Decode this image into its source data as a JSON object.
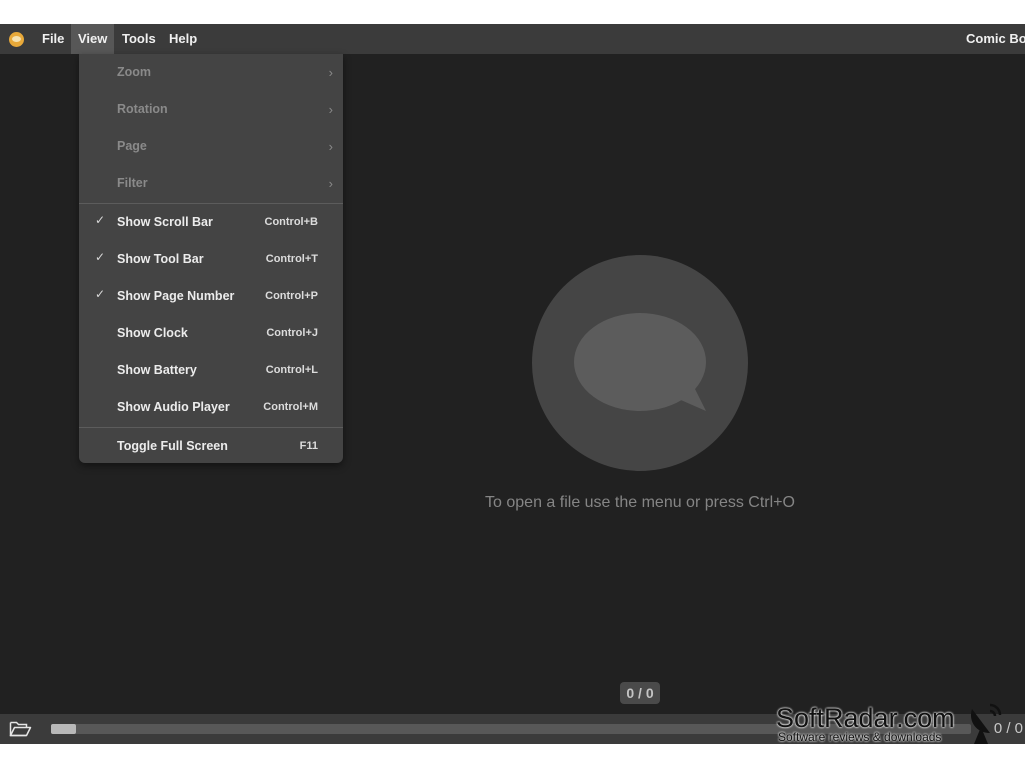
{
  "menubar": {
    "items": [
      {
        "label": "File"
      },
      {
        "label": "View"
      },
      {
        "label": "Tools"
      },
      {
        "label": "Help"
      }
    ],
    "app_title": "Comic Boo"
  },
  "view_menu": {
    "submenus": [
      {
        "label": "Zoom",
        "enabled": false,
        "arrow": "›"
      },
      {
        "label": "Rotation",
        "enabled": false,
        "arrow": "›"
      },
      {
        "label": "Page",
        "enabled": false,
        "arrow": "›"
      },
      {
        "label": "Filter",
        "enabled": false,
        "arrow": "›"
      }
    ],
    "toggles": [
      {
        "label": "Show Scroll Bar",
        "shortcut": "Control+B",
        "checked": true
      },
      {
        "label": "Show Tool Bar",
        "shortcut": "Control+T",
        "checked": true
      },
      {
        "label": "Show Page Number",
        "shortcut": "Control+P",
        "checked": true
      },
      {
        "label": "Show Clock",
        "shortcut": "Control+J",
        "checked": false
      },
      {
        "label": "Show Battery",
        "shortcut": "Control+L",
        "checked": false
      },
      {
        "label": "Show Audio Player",
        "shortcut": "Control+M",
        "checked": false
      }
    ],
    "fullscreen": {
      "label": "Toggle Full Screen",
      "shortcut": "F11"
    },
    "check_glyph": "✓"
  },
  "main": {
    "hint": "To open a file use the menu or press Ctrl+O",
    "page_counter": "0 / 0"
  },
  "toolbar": {
    "pages": "0 / 0",
    "scroll_fraction": 0.027
  },
  "watermark": {
    "name": "SoftRadar.com",
    "tagline": "Software reviews & downloads"
  },
  "icons": {
    "app": "comic-bubble-icon",
    "open": "folder-open-icon",
    "placeholder": "speech-bubble-icon",
    "watermark": "satellite-dish-icon"
  },
  "colors": {
    "background": "#212121",
    "menubar": "#3b3b3b",
    "dropdown": "#444444",
    "accent": "#e8a93a"
  }
}
